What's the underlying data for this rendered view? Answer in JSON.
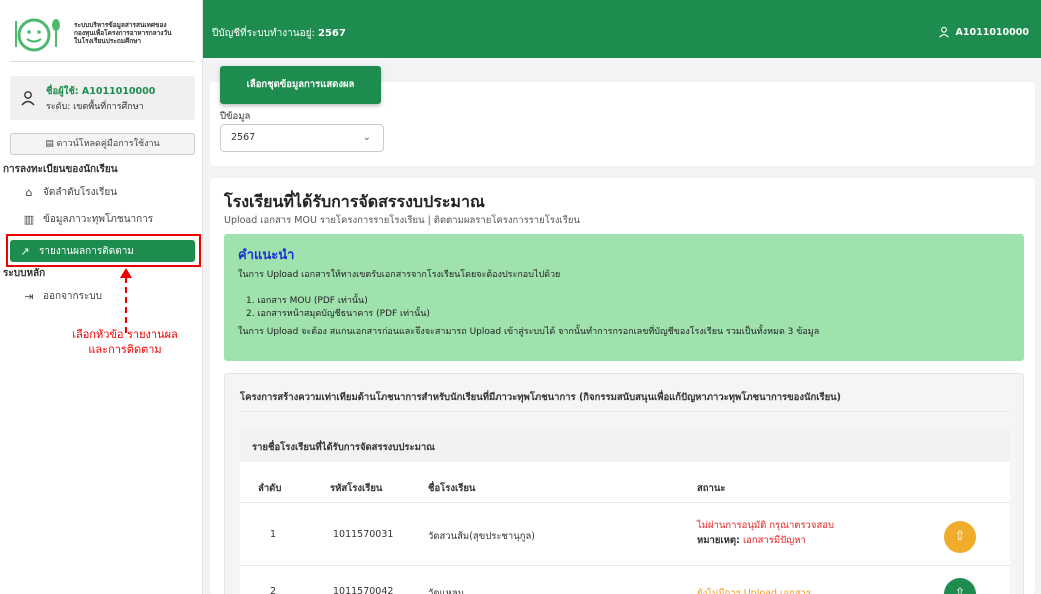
{
  "logo": {
    "line1": "ระบบบริหารข้อมูลสารสนเทศของ",
    "line2": "กองทุนเพื่อโครงการอาหารกลางวัน",
    "line3": "ในโรงเรียนประถมศึกษา"
  },
  "user": {
    "name": "ชื่อผู้ใช้: A1011010000",
    "level": "ระดับ: เขตพื้นที่การศึกษา"
  },
  "sidebar": {
    "download_label": "ดาวน์โหลดคู่มือการใช้งาน",
    "section1_title": "การลงทะเบียนของนักเรียน",
    "items": [
      {
        "label": "จัดลำดับโรงเรียน"
      },
      {
        "label": "ข้อมูลภาวะทุพโภชนาการ"
      },
      {
        "label": "รายงานผลการติดตาม"
      }
    ],
    "section2_title": "ระบบหลัก",
    "logout_label": "ออกจากระบบ"
  },
  "annotation": {
    "line1": "เลือกหัวข้อ รายงานผล",
    "line2": "และการติดตาม"
  },
  "header": {
    "year_prefix": "ปีบัญชีที่ระบบทำงานอยู่:",
    "year_value": "2567",
    "username": "A1011010000"
  },
  "filter": {
    "button_label": "เลือกชุดข้อมูลการแสดงผล",
    "field_label": "ปีข้อมูล",
    "selected_year": "2567"
  },
  "page": {
    "title": "โรงเรียนที่ได้รับการจัดสรรงบประมาณ",
    "subtitle": "Upload เอกสาร MOU รายโครงการรายโรงเรียน | ติดตามผลรายโครงการรายโรงเรียน"
  },
  "note": {
    "title": "คำแนะนำ",
    "intro": "ในการ Upload เอกสารให้ทางเขตรับเอกสารจากโรงเรียนโดยจะต้องประกอบไปด้วย",
    "item1": "1. เอกสาร MOU (PDF เท่านั้น)",
    "item2": "2. เอกสารหน้าสมุดบัญชีธนาคาร (PDF เท่านั้น)",
    "footer": "ในการ Upload จะต้อง สแกนเอกสารก่อนและจึงจะสามารถ Upload เข้าสู่ระบบได้ จากนั้นทำการกรอกเลขที่บัญชีของโรงเรียน รวมเป็นทั้งหมด 3 ข้อมูล"
  },
  "project": {
    "title": "โครงการสร้างความเท่าเทียมด้านโภชนาการสำหรับนักเรียนที่มีภาวะทุพโภชนาการ (กิจกรรมสนับสนุนเพื่อแก้ปัญหาภาวะทุพโภชนาการของนักเรียน)"
  },
  "school_list": {
    "title": "รายชื่อโรงเรียนที่ได้รับการจัดสรรงบประมาณ",
    "columns": [
      "ลำดับ",
      "รหัสโรงเรียน",
      "ชื่อโรงเรียน",
      "สถานะ"
    ],
    "rows": [
      {
        "no": "1",
        "code": "1011570031",
        "name": "วัดสวนส้ม(สุขประชานุกูล)",
        "status": "ไม่ผ่านการอนุมัติ กรุณาตรวจสอบ",
        "remark_label": "หมายเหตุ:",
        "remark": "เอกสารมีปัญหา"
      },
      {
        "no": "2",
        "code": "1011570042",
        "name": "วัดแหลม",
        "status": "ยังไม่มีการ Upload เอกสาร"
      }
    ]
  },
  "colors": {
    "primary": "#1e8c4e",
    "note_bg": "#9fe2ae",
    "warning": "#f0ad2b",
    "danger": "#e52222"
  }
}
